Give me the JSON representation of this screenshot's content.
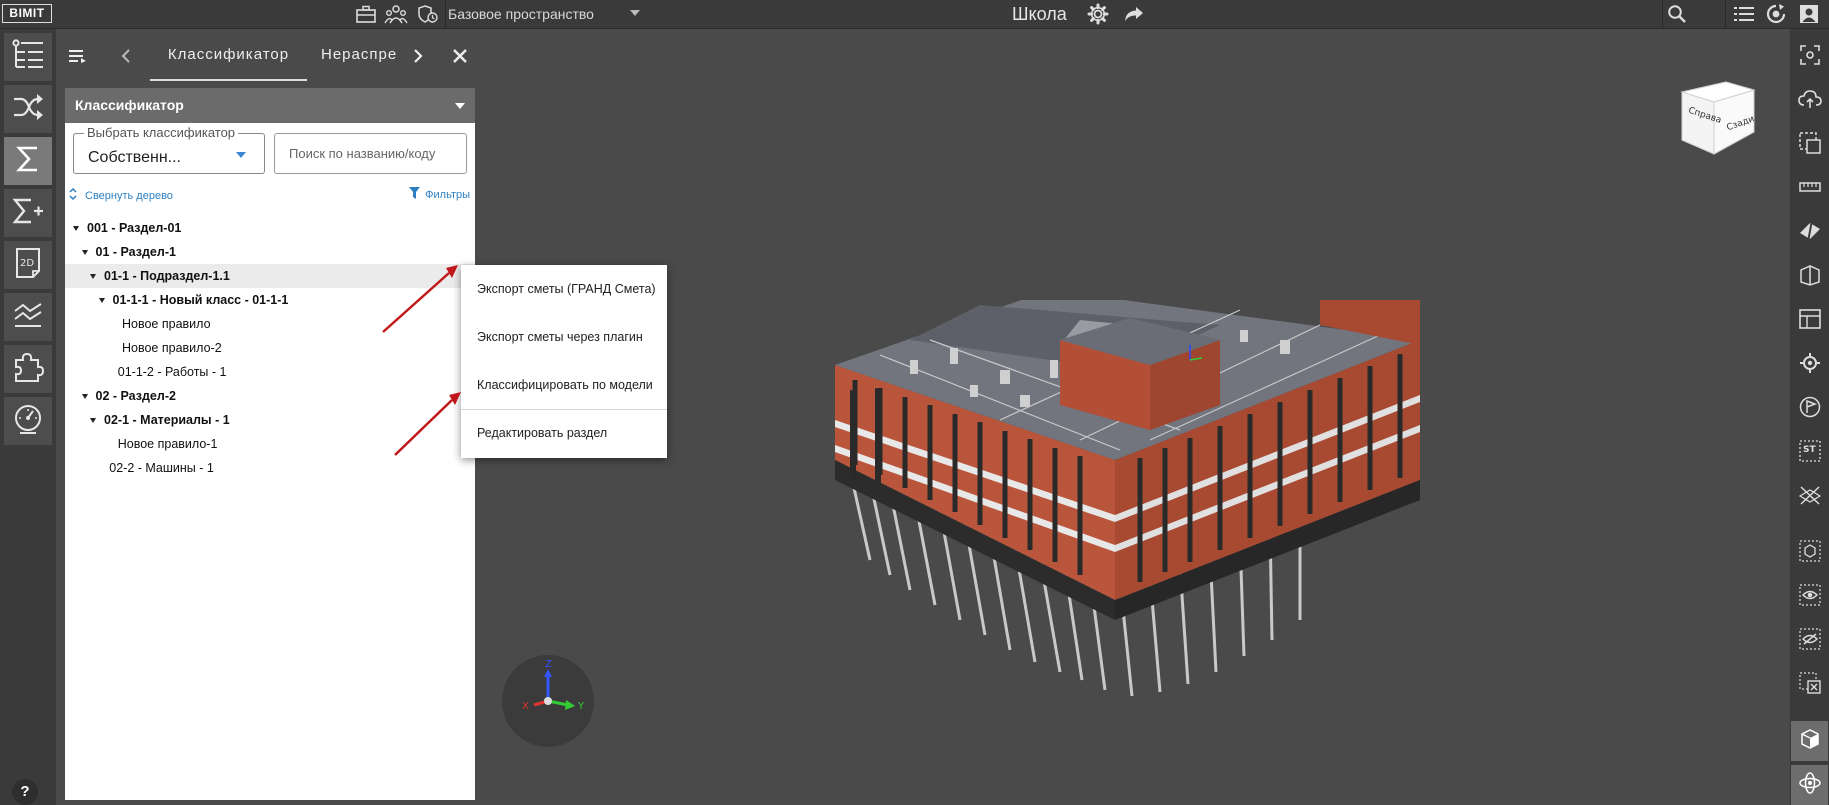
{
  "topbar": {
    "logo": "BIMIT",
    "space_select": "Базовое пространство",
    "project_title": "Школа"
  },
  "left_rail": {
    "items": [
      {
        "icon": "tree-structure-icon"
      },
      {
        "icon": "shuffle-icon"
      },
      {
        "icon": "sigma-icon",
        "active": true
      },
      {
        "icon": "sigma-plus-icon"
      },
      {
        "icon": "2d-drawing-icon"
      },
      {
        "icon": "chart-lines-icon"
      },
      {
        "icon": "puzzle-icon"
      },
      {
        "icon": "gauge-icon"
      }
    ],
    "help_label": "?"
  },
  "panel_tabs": {
    "active": "Классификатор",
    "next": "Нераспре"
  },
  "panel": {
    "header": "Классификатор",
    "classifier_select": {
      "legend": "Выбрать классификатор",
      "value": "Собственн..."
    },
    "search_placeholder": "Поиск по названию/коду",
    "collapse_label": "Свернуть дерево",
    "filters_label": "Фильтры",
    "tree": [
      {
        "label": "001 - Раздел-01",
        "level": 0,
        "bold": true,
        "caret": true
      },
      {
        "label": "01 - Раздел-1",
        "level": 1,
        "bold": true,
        "caret": true
      },
      {
        "label": "01-1 - Подраздел-1.1",
        "level": 2,
        "bold": true,
        "caret": true,
        "selected": true
      },
      {
        "label": "01-1-1 - Новый класс - 01-1-1",
        "level": 3,
        "bold": true,
        "caret": true
      },
      {
        "label": "Новое правило",
        "level": 4,
        "bold": false,
        "caret": false
      },
      {
        "label": "Новое правило-2",
        "level": 4,
        "bold": false,
        "caret": false
      },
      {
        "label": "01-1-2 - Работы - 1",
        "level": 3.5,
        "bold": false,
        "caret": false
      },
      {
        "label": "02 - Раздел-2",
        "level": 1,
        "bold": true,
        "caret": true
      },
      {
        "label": "02-1 - Материалы - 1",
        "level": 2,
        "bold": true,
        "caret": true
      },
      {
        "label": "Новое правило-1",
        "level": 3.5,
        "bold": false,
        "caret": false
      },
      {
        "label": "02-2 - Машины - 1",
        "level": 2.5,
        "bold": false,
        "caret": false
      }
    ]
  },
  "context_menu": {
    "items": [
      "Экспорт сметы (ГРАНД Смета)",
      "Экспорт сметы через плагин",
      "Классифицировать по модели",
      "Редактировать раздел"
    ]
  },
  "viewcube": {
    "faces": [
      "Справа",
      "Сзади"
    ]
  },
  "axis_gizmo": {
    "x": "X",
    "y": "Y",
    "z": "Z"
  },
  "colors": {
    "accent": "#2d7fc1",
    "toolbar_bg": "#3a3a3a",
    "viewport_bg": "#4a4a4a",
    "arrow": "#c0181a"
  }
}
